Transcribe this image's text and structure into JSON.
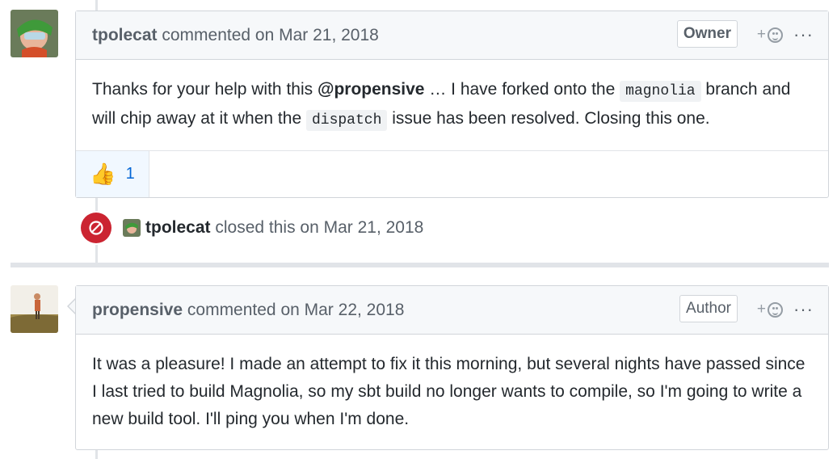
{
  "comments": [
    {
      "author": "tpolecat",
      "action": "commented on Mar 21, 2018",
      "role": "Owner",
      "body": {
        "p1": "Thanks for your help with this ",
        "mention": "@propensive",
        "p2": " … I have forked onto the ",
        "code1": "magnolia",
        "p3": " branch and will chip away at it when the ",
        "code2": "dispatch",
        "p4": " issue has been resolved. Closing this one."
      },
      "reactions": [
        {
          "emoji": "👍",
          "count": "1"
        }
      ]
    },
    {
      "author": "propensive",
      "action": "commented on Mar 22, 2018",
      "role": "Author",
      "body": "It was a pleasure! I made an attempt to fix it this morning, but several nights have passed since I last tried to build Magnolia, so my sbt build no longer wants to compile, so I'm going to write a new build tool. I'll ping you when I'm done."
    }
  ],
  "event": {
    "actor": "tpolecat",
    "text": "closed this on Mar 21, 2018",
    "icon": "closed-issue-icon",
    "color": "#cb2431"
  },
  "ui": {
    "add_reaction_plus": "+",
    "more": "···"
  }
}
